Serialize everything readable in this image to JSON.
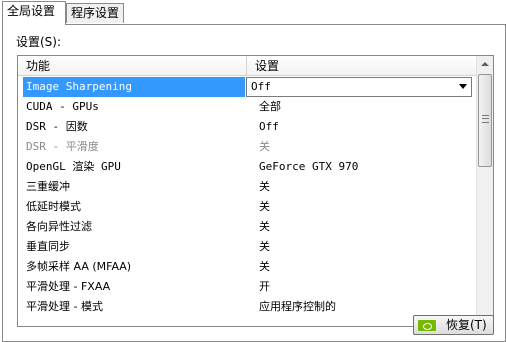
{
  "tabs": [
    {
      "label": "全局设置",
      "active": true
    },
    {
      "label": "程序设置",
      "active": false
    }
  ],
  "settings_label": "设置(S):",
  "grid": {
    "columns": [
      "功能",
      "设置"
    ],
    "rows": [
      {
        "feature": "Image Sharpening",
        "value": "Off",
        "state": "selected"
      },
      {
        "feature": "CUDA - GPUs",
        "value": "全部"
      },
      {
        "feature": "DSR - 因数",
        "value": "Off"
      },
      {
        "feature": "DSR - 平滑度",
        "value": "关",
        "state": "disabled"
      },
      {
        "feature": "OpenGL 渲染 GPU",
        "value": "GeForce GTX 970"
      },
      {
        "feature": "三重缓冲",
        "value": "关"
      },
      {
        "feature": "低延时模式",
        "value": "关"
      },
      {
        "feature": "各向异性过滤",
        "value": "关"
      },
      {
        "feature": "垂直同步",
        "value": "关"
      },
      {
        "feature": "多帧采样 AA (MFAA)",
        "value": "关"
      },
      {
        "feature": "平滑处理 - FXAA",
        "value": "开"
      },
      {
        "feature": "平滑处理 - 模式",
        "value": "应用程序控制的"
      }
    ]
  },
  "scroll": {
    "position_fraction": 0.0
  },
  "restore_button": {
    "label": "恢复(T)",
    "icon": "nvidia-logo-icon"
  },
  "colors": {
    "selection": "#3399ff",
    "nvidia_green": "#76b900"
  }
}
